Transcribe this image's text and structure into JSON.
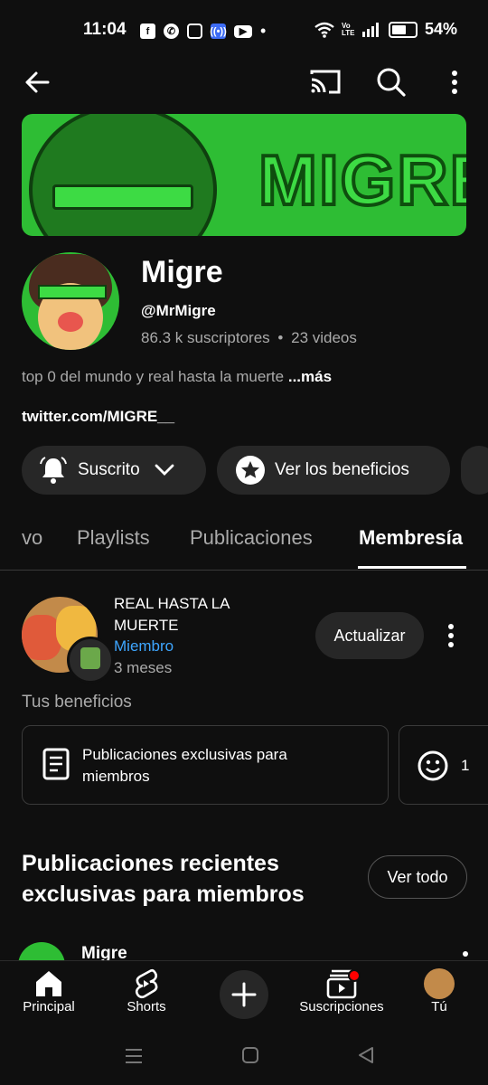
{
  "status_bar": {
    "time": "11:04",
    "battery": "54%",
    "app_icons": [
      "facebook-icon",
      "whatsapp-icon",
      "instagram-icon",
      "hotspot-icon",
      "youtube-icon"
    ],
    "volte": "Vo LTE"
  },
  "channel": {
    "banner_text": "MIGRE",
    "name": "Migre",
    "handle": "@MrMigre",
    "subscribers": "86.3 k suscriptores",
    "separator": "•",
    "videos": "23 videos",
    "description": "top 0 del mundo y real hasta la muerte",
    "more": "...más",
    "link": "twitter.com/MIGRE__"
  },
  "actions": {
    "subscribed": "Suscrito",
    "benefits": "Ver los beneficios"
  },
  "tabs": [
    {
      "label": "vo",
      "active": false
    },
    {
      "label": "Playlists",
      "active": false
    },
    {
      "label": "Publicaciones",
      "active": false
    },
    {
      "label": "Membresía",
      "active": true
    }
  ],
  "membership": {
    "level_title": "REAL HASTA LA MUERTE",
    "role": "Miembro",
    "duration": "3 meses",
    "upgrade": "Actualizar",
    "benefits_header": "Tus beneficios",
    "benefit_card": "Publicaciones exclusivas para miembros",
    "benefit_card2_partial": "1"
  },
  "recent": {
    "title": "Publicaciones recientes exclusivas para miembros",
    "see_all": "Ver todo",
    "post_author": "Migre"
  },
  "bottom_nav": [
    {
      "label": "Principal",
      "icon": "home-icon"
    },
    {
      "label": "Shorts",
      "icon": "shorts-icon"
    },
    {
      "label": "",
      "icon": "create-icon"
    },
    {
      "label": "Suscripciones",
      "icon": "subscriptions-icon"
    },
    {
      "label": "Tú",
      "icon": "avatar"
    }
  ],
  "colors": {
    "background": "#0f0f0f",
    "pill": "#272727",
    "member_blue": "#3ea6ff",
    "banner_green": "#2ebd34",
    "notification_red": "#ff0000"
  }
}
